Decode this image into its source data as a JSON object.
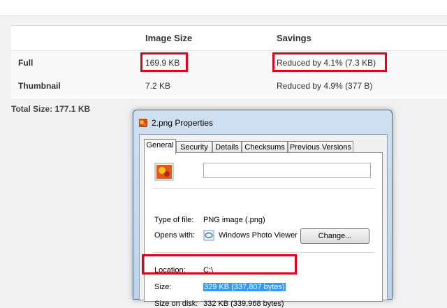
{
  "table": {
    "headers": {
      "size": "Image Size",
      "savings": "Savings"
    },
    "rows": [
      {
        "label": "Full",
        "size": "169.9 KB",
        "savings": "Reduced by 4.1% (7.3 KB)"
      },
      {
        "label": "Thumbnail",
        "size": "7.2 KB",
        "savings": "Reduced by 4.9% (377 B)"
      }
    ],
    "total": "Total Size: 177.1 KB"
  },
  "dialog": {
    "title": "2.png Properties",
    "tabs": [
      "General",
      "Security",
      "Details",
      "Checksums",
      "Previous Versions"
    ],
    "active_tab": "General",
    "fields": {
      "type_label": "Type of file:",
      "type_value": "PNG image (.png)",
      "opens_label": "Opens with:",
      "opens_value": "Windows Photo Viewer",
      "change_button": "Change...",
      "location_label": "Location:",
      "location_value": "C:\\",
      "size_label": "Size:",
      "size_value": "329 KB (337,807 bytes)",
      "disk_label": "Size on disk:",
      "disk_value": "332 KB (339,968 bytes)"
    }
  },
  "icons": {
    "file": "image-file-icon",
    "viewer": "photo-viewer-icon"
  },
  "colors": {
    "highlight_box": "#e3001b",
    "selection": "#3399ff"
  }
}
